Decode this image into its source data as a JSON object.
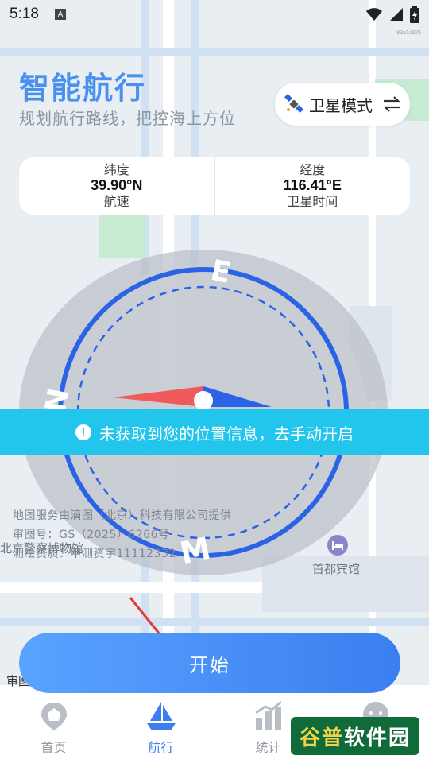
{
  "status_bar": {
    "time": "5:18",
    "badge": "A",
    "build_id": "83a1c925"
  },
  "header": {
    "title": "智能航行",
    "subtitle": "规划航行路线，把控海上方位"
  },
  "mode_button": {
    "label": "卫星模式",
    "icon": "satellite-icon",
    "switch_icon": "swap-icon"
  },
  "info": {
    "lat_label": "纬度",
    "lat_value": "39.90°N",
    "speed_label": "航速",
    "lng_label": "经度",
    "lng_value": "116.41°E",
    "sat_time_label": "卫星时间"
  },
  "compass": {
    "letters": [
      "E",
      "N",
      "M"
    ],
    "needle_colors": [
      "#f05a5a",
      "#2b63e6"
    ]
  },
  "banner": {
    "text": "未获取到您的位置信息，去手动开启",
    "color": "#22c6ec"
  },
  "map": {
    "attribution_1": "地图服务由滴图（北京）科技有限公司提供",
    "attribution_2": "审图号：GS（2025）6266号",
    "attribution_3": "测绘资质：甲测资字11112332",
    "poi_1": "北京警察博物馆",
    "poi_2": "首都宾馆",
    "poi_3": "审图"
  },
  "start_button": {
    "label": "开始"
  },
  "bottom_nav": {
    "items": [
      {
        "label": "首页",
        "icon": "home-pin-icon",
        "active": false
      },
      {
        "label": "航行",
        "icon": "sailboat-icon",
        "active": true
      },
      {
        "label": "统计",
        "icon": "stats-icon",
        "active": false
      },
      {
        "label": "我的",
        "icon": "profile-icon",
        "active": false
      }
    ]
  },
  "watermark": {
    "brand_a": "谷普",
    "brand_b": "软件园"
  },
  "colors": {
    "accent": "#3b7ef0",
    "title": "#4a90f0"
  }
}
